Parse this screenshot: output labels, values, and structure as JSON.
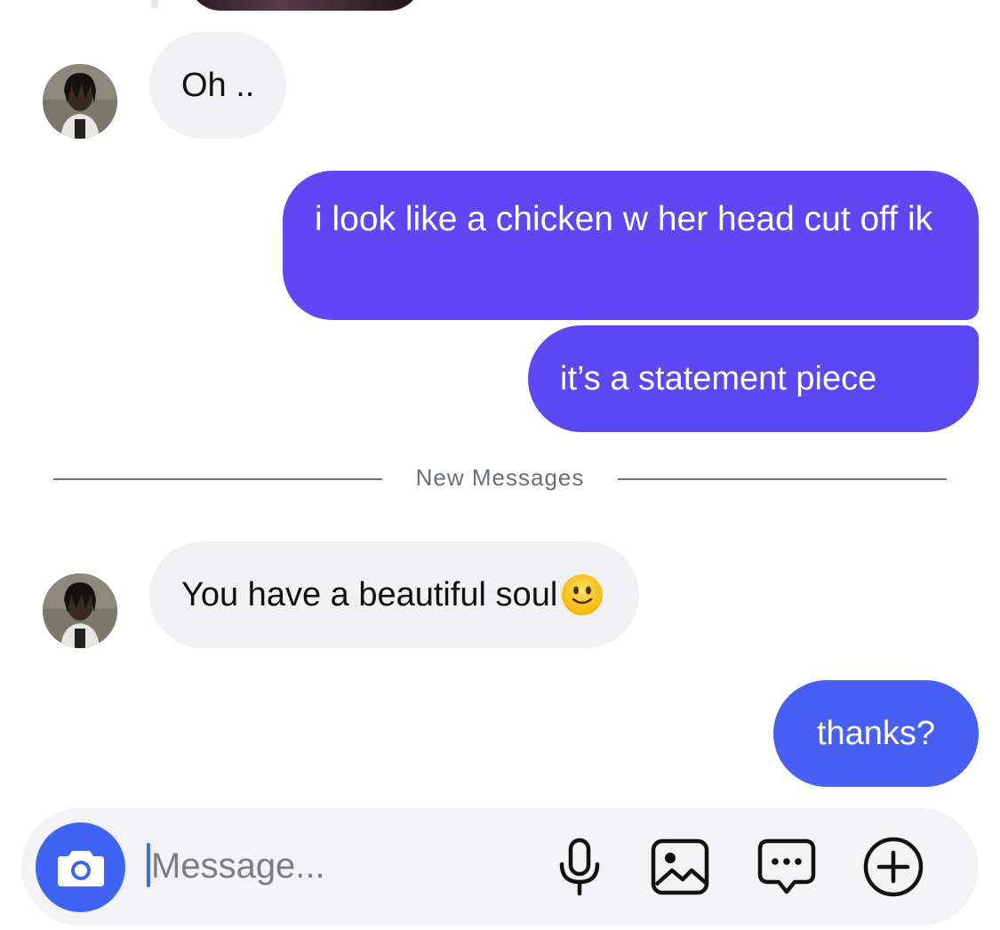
{
  "messages": [
    {
      "id": "m1",
      "direction": "incoming",
      "text": "Oh .."
    },
    {
      "id": "m2",
      "direction": "outgoing",
      "text": "i look like a chicken w her head cut off ik"
    },
    {
      "id": "m3",
      "direction": "outgoing",
      "text": "it’s a statement piece"
    },
    {
      "id": "m4",
      "direction": "incoming",
      "text": "You have a beautiful soul",
      "emoji": "slightly-smiling-face"
    },
    {
      "id": "m5",
      "direction": "outgoing",
      "text": "thanks?"
    }
  ],
  "divider": {
    "label": "New Messages"
  },
  "composer": {
    "placeholder": "Message...",
    "value": "",
    "icons": [
      "camera-icon",
      "microphone-icon",
      "image-icon",
      "chat-dots-icon",
      "plus-circle-icon"
    ]
  },
  "colors": {
    "incoming_bubble": "#f1f1f3",
    "outgoing_top": "#6245f3",
    "outgoing_mid": "#5b48f2",
    "outgoing_bottom": "#4760f3",
    "camera_button": "#3f64f4"
  }
}
